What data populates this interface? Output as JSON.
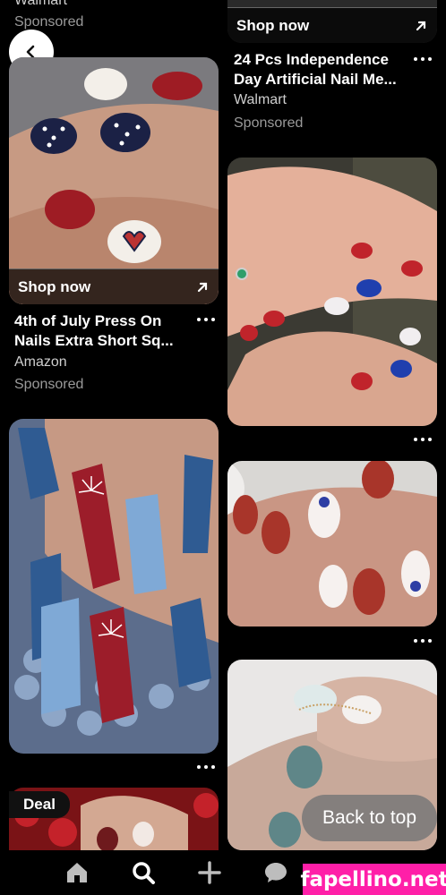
{
  "top_fragments": {
    "left_merchant": "Walmart",
    "left_sponsored": "Sponsored"
  },
  "left_column": {
    "pin1": {
      "shop_label": "Shop now",
      "title": "4th of July Press On Nails Extra Short Sq...",
      "merchant": "Amazon",
      "sponsored": "Sponsored"
    },
    "deal_badge": "Deal"
  },
  "right_column": {
    "pin0": {
      "shop_label": "Shop now",
      "title": "24 Pcs Independence Day Artificial Nail Me...",
      "merchant": "Walmart",
      "sponsored": "Sponsored"
    }
  },
  "overlay": {
    "back_to_top": "Back to top"
  },
  "bottom_nav": {
    "items": [
      "home-icon",
      "search-icon",
      "create-icon",
      "messages-icon"
    ]
  },
  "watermark": "fapellino.net",
  "colors": {
    "background": "#000000",
    "text_primary": "#ffffff",
    "text_secondary": "#9a9a9a",
    "watermark_bg": "#ff1fa8"
  }
}
